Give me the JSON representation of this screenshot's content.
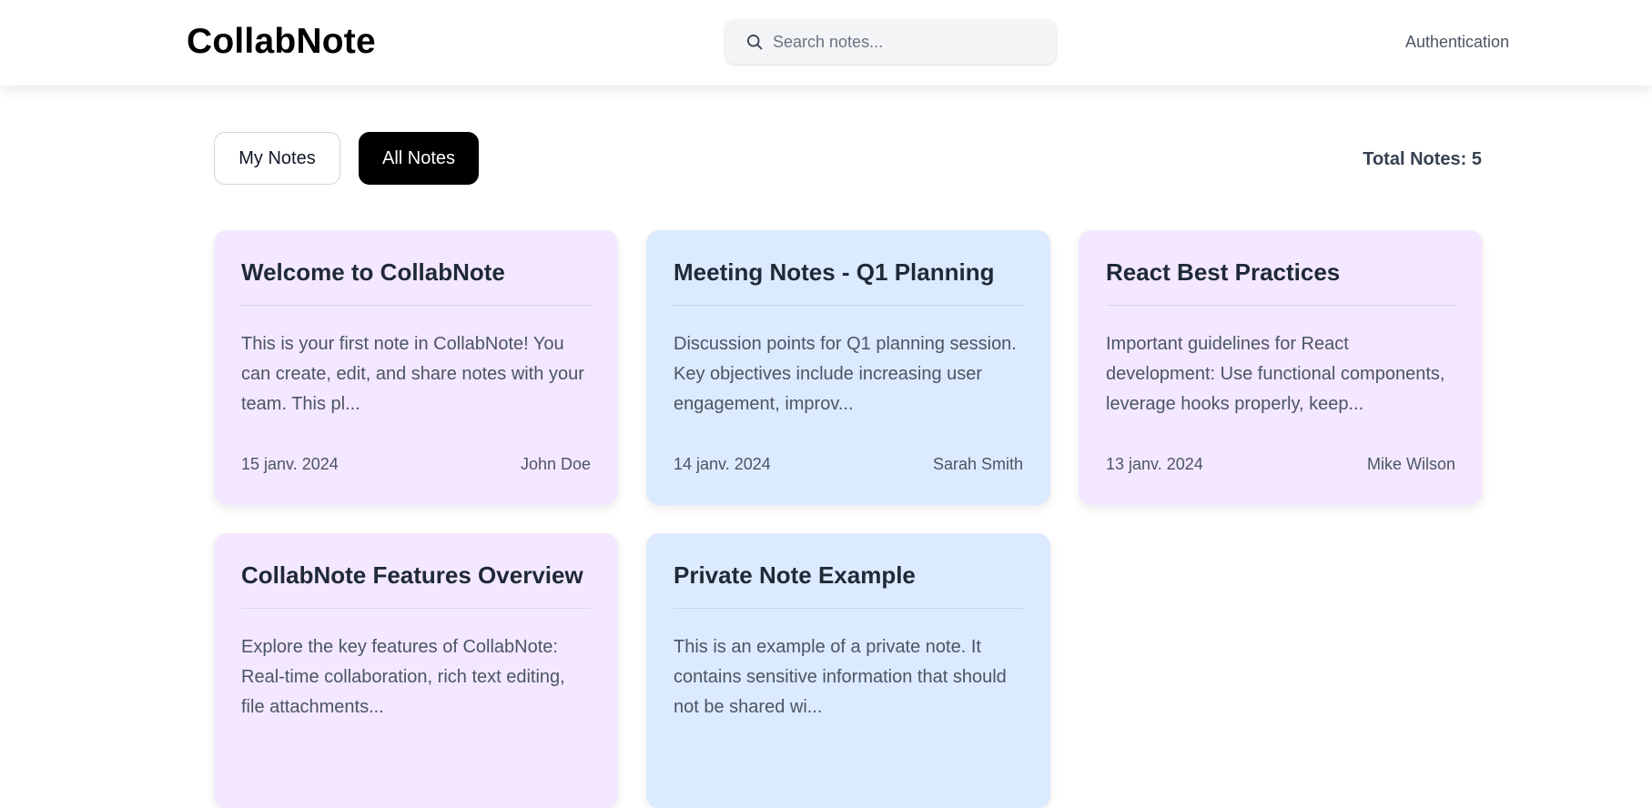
{
  "header": {
    "logo": "CollabNote",
    "search_placeholder": "Search notes...",
    "auth_link": "Authentication"
  },
  "tabs": [
    {
      "label": "My Notes",
      "active": false
    },
    {
      "label": "All Notes",
      "active": true
    }
  ],
  "total_notes": "Total Notes: 5",
  "notes": [
    {
      "title": "Welcome to CollabNote",
      "excerpt": "This is your first note in CollabNote! You can create, edit, and share notes with your team. This pl...",
      "date": "15 janv. 2024",
      "author": "John Doe",
      "color": "#f3e8ff"
    },
    {
      "title": "Meeting Notes - Q1 Planning",
      "excerpt": "Discussion points for Q1 planning session. Key objectives include increasing user engagement, improv...",
      "date": "14 janv. 2024",
      "author": "Sarah Smith",
      "color": "#dbeafe"
    },
    {
      "title": "React Best Practices",
      "excerpt": "Important guidelines for React development: Use functional components, leverage hooks properly, keep...",
      "date": "13 janv. 2024",
      "author": "Mike Wilson",
      "color": "#f3e8ff"
    },
    {
      "title": "CollabNote Features Overview",
      "excerpt": "Explore the key features of CollabNote: Real-time collaboration, rich text editing, file attachments...",
      "date": "",
      "author": "",
      "color": "#f3e8ff"
    },
    {
      "title": "Private Note Example",
      "excerpt": "This is an example of a private note. It contains sensitive information that should not be shared wi...",
      "date": "",
      "author": "",
      "color": "#dbeafe"
    }
  ],
  "icons": {
    "search": "search-icon"
  }
}
